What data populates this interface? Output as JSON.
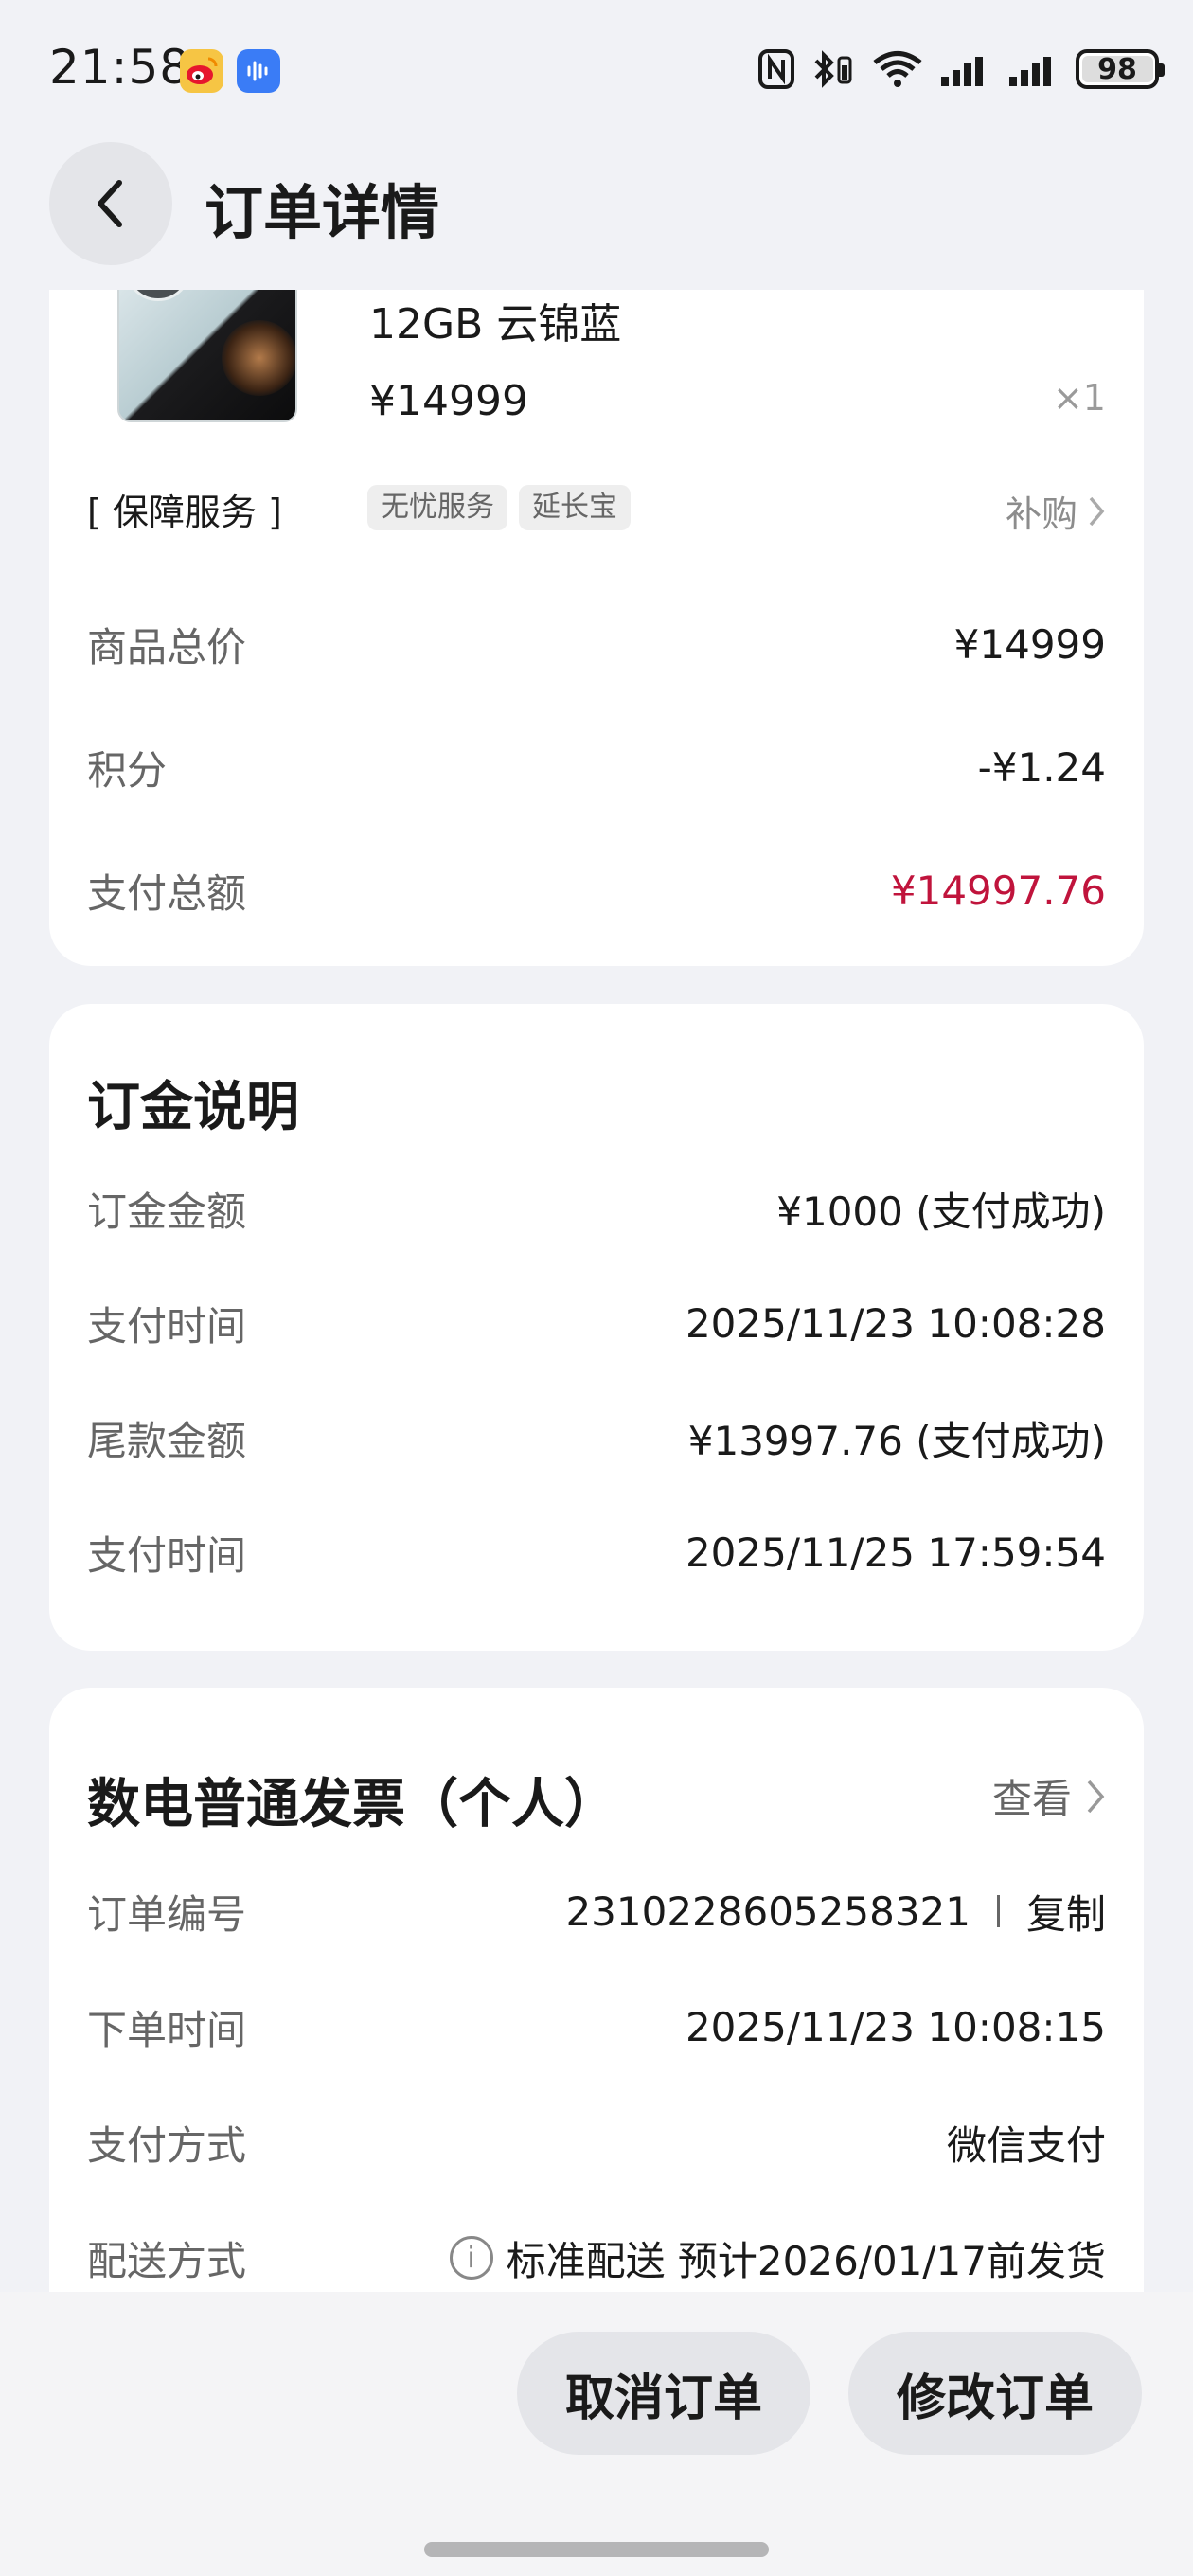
{
  "status_bar": {
    "time": "21:58",
    "battery": "98",
    "icons": [
      "weibo-icon",
      "voice-icon",
      "nfc-icon",
      "bluetooth-icon",
      "wifi-icon",
      "signal-icon",
      "signal-icon",
      "battery-icon"
    ]
  },
  "header": {
    "title": "订单详情"
  },
  "product": {
    "spec": "12GB 云锦蓝",
    "price": "¥14999",
    "quantity": "×1"
  },
  "service": {
    "label": "[ 保障服务 ]",
    "tags": [
      "无忧服务",
      "延长宝"
    ],
    "buy_label": "补购"
  },
  "summary": [
    {
      "label": "商品总价",
      "value": "¥14999"
    },
    {
      "label": "积分",
      "value": "-¥1.24"
    },
    {
      "label": "支付总额",
      "value": "¥14997.76"
    }
  ],
  "deposit": {
    "title": "订金说明",
    "rows": [
      {
        "label": "订金金额",
        "value": "¥1000 (支付成功)"
      },
      {
        "label": "支付时间",
        "value": "2025/11/23 10:08:28"
      },
      {
        "label": "尾款金额",
        "value": "¥13997.76 (支付成功)"
      },
      {
        "label": "支付时间",
        "value": "2025/11/25 17:59:54"
      }
    ]
  },
  "invoice": {
    "title": "数电普通发票（个人）",
    "view_label": "查看",
    "rows": [
      {
        "label": "订单编号",
        "value": "2310228605258321",
        "action": "复制"
      },
      {
        "label": "下单时间",
        "value": "2025/11/23 10:08:15"
      },
      {
        "label": "支付方式",
        "value": "微信支付"
      },
      {
        "label": "配送方式",
        "value": "标准配送 预计2026/01/17前发货"
      }
    ]
  },
  "actions": {
    "cancel": "取消订单",
    "modify": "修改订单"
  },
  "colors": {
    "accent_red": "#c0143c",
    "background": "#f1f2f6"
  }
}
